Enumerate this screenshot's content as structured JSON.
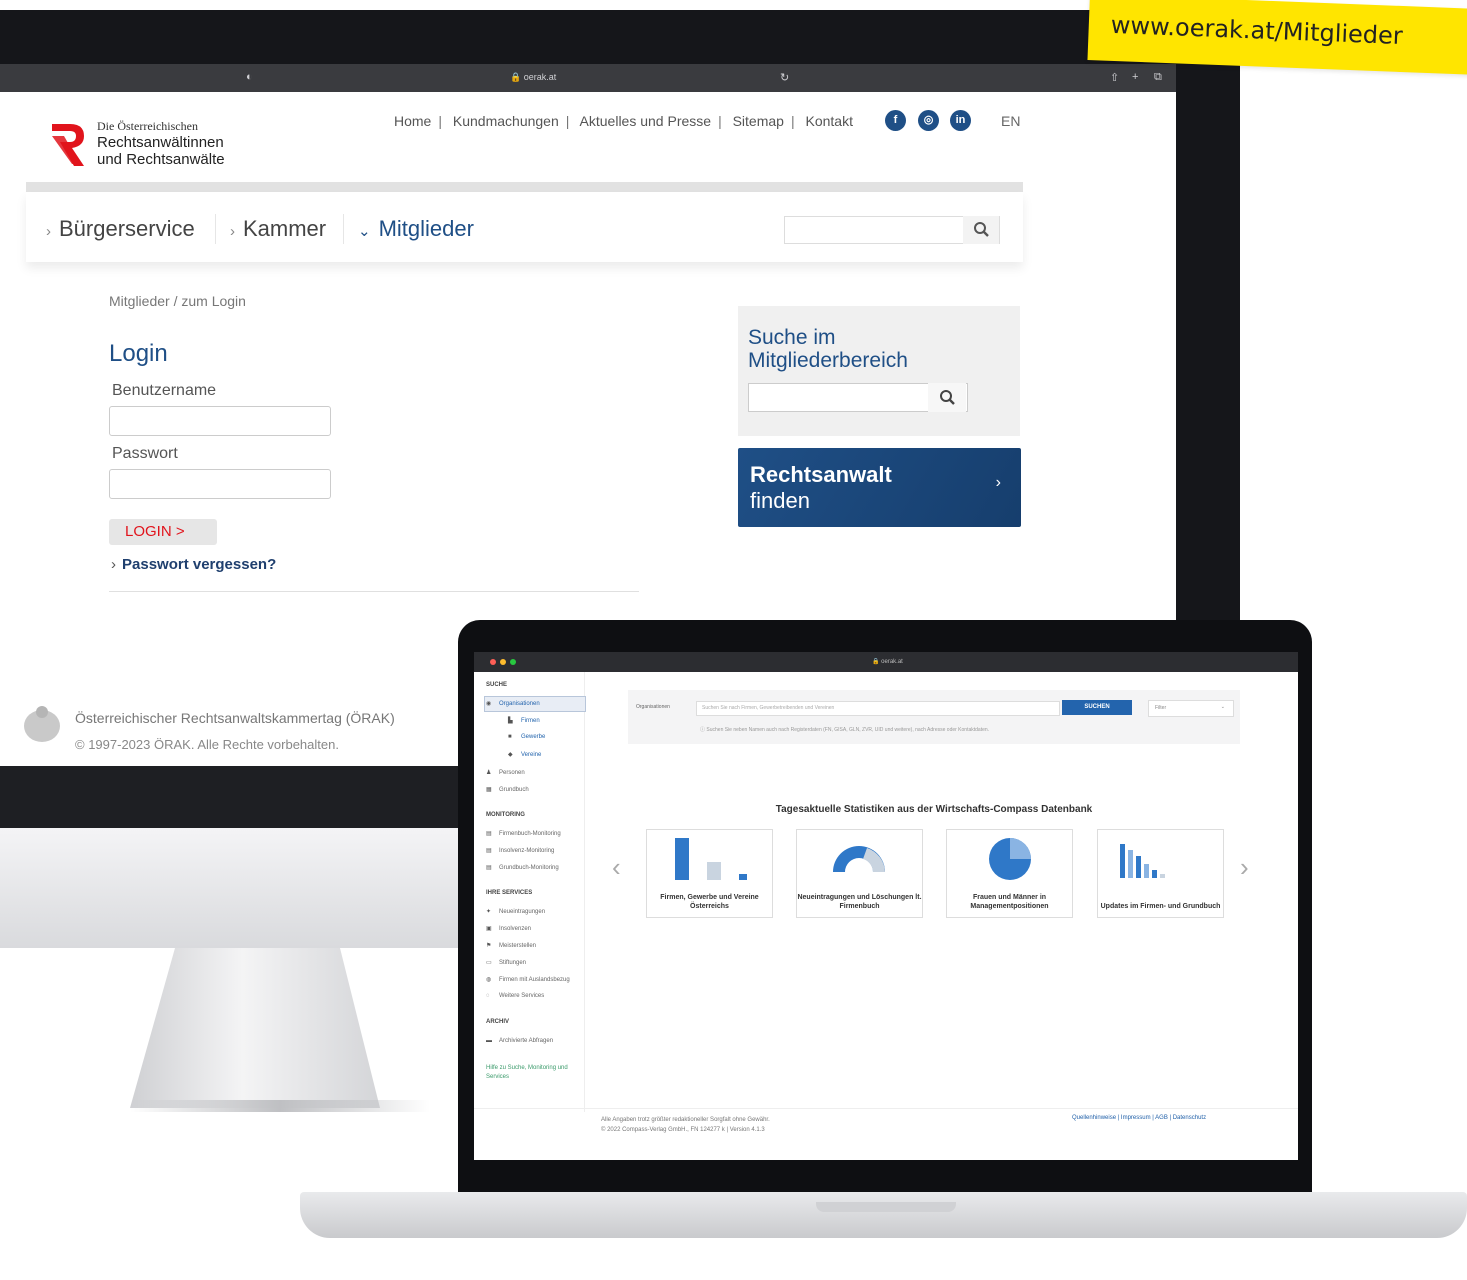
{
  "banner": {
    "url": "www.oerak.at/Mitglieder"
  },
  "browser": {
    "url": "oerak.at"
  },
  "site": {
    "logo_line1": "Die Österreichischen",
    "logo_line2": "Rechtsanwältinnen",
    "logo_line3": "und Rechtsanwälte",
    "topnav": [
      "Home",
      "Kundmachungen",
      "Aktuelles und Presse",
      "Sitemap",
      "Kontakt"
    ],
    "lang": "EN",
    "mainnav": [
      "Bürgerservice",
      "Kammer",
      "Mitglieder"
    ],
    "breadcrumb": "Mitglieder / zum Login",
    "login_title": "Login",
    "username_label": "Benutzername",
    "password_label": "Passwort",
    "login_button": "LOGIN >",
    "forgot": "Passwort vergessen?",
    "side_search_title1": "Suche im",
    "side_search_title2": "Mitgliederbereich",
    "find_lawyer1": "Rechtsanwalt",
    "find_lawyer2": "finden",
    "footer_org": "Österreichischer Rechtsanwaltskammertag (ÖRAK)",
    "footer_copy": "© 1997-2023 ÖRAK. Alle Rechte vorbehalten."
  },
  "compass": {
    "url": "oerak.at",
    "sections": {
      "suche": "SUCHE",
      "monitoring": "MONITORING",
      "services": "IHRE SERVICES",
      "archiv": "ARCHIV"
    },
    "suche_items": [
      "Organisationen",
      "Firmen",
      "Gewerbe",
      "Vereine",
      "Personen",
      "Grundbuch"
    ],
    "monitoring_items": [
      "Firmenbuch-Monitoring",
      "Insolvenz-Monitoring",
      "Grundbuch-Monitoring"
    ],
    "service_items": [
      "Neueintragungen",
      "Insolvenzen",
      "Meisterstellen",
      "Stiftungen",
      "Firmen mit Auslandsbezug",
      "Weitere Services"
    ],
    "archiv_items": [
      "Archivierte Abfragen"
    ],
    "help": "Hilfe zu Suche, Monitoring und Services",
    "search_label": "Organisationen",
    "search_placeholder": "Suchen Sie nach Firmen, Gewerbetreibenden und Vereinen",
    "search_button": "SUCHEN",
    "filter": "Filter",
    "hint": "Suchen Sie neben Namen auch nach Registerdaten (FN, GISA, GLN, ZVR, UID und weitere), nach Adresse oder Kontaktdaten.",
    "stats_title": "Tagesaktuelle Statistiken aus der Wirtschafts-Compass Datenbank",
    "cards": [
      "Firmen, Gewerbe und Vereine Österreichs",
      "Neueintragungen und Löschungen lt. Firmenbuch",
      "Frauen und Männer in Managementpositionen",
      "Updates im Firmen- und Grundbuch"
    ],
    "footer_line1": "Alle Angaben trotz größter redaktioneller Sorgfalt ohne Gewähr.",
    "footer_line2": "© 2022 Compass-Verlag GmbH., FN 124277 k | Version 4.1.3",
    "footer_links": "Quellenhinweise | Impressum | AGB | Datenschutz"
  },
  "colors": {
    "brand_blue": "#1f4f86",
    "brand_red": "#e1141c",
    "banner_yellow": "#ffe500",
    "compass_blue": "#2364ad"
  }
}
